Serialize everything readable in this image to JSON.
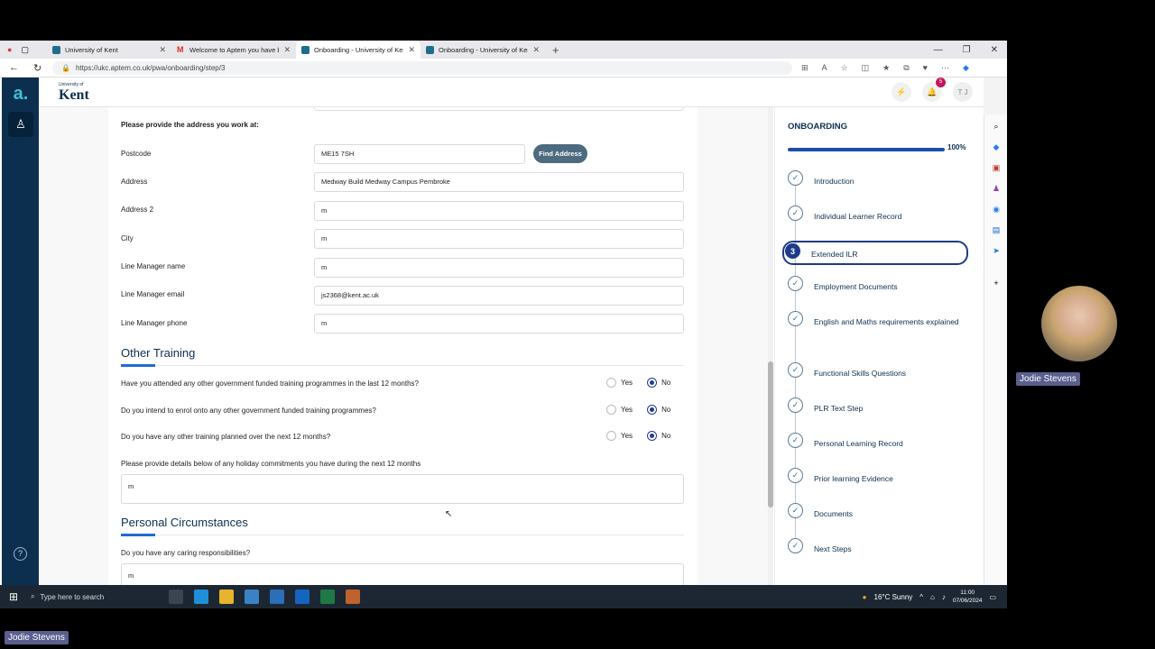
{
  "browser": {
    "tabs": [
      {
        "title": "University of Kent",
        "active": false,
        "favicon": "aptem"
      },
      {
        "title": "Welcome to Aptem you have be",
        "active": false,
        "favicon": "gmail"
      },
      {
        "title": "Onboarding - University of Kent",
        "active": true,
        "favicon": "aptem"
      },
      {
        "title": "Onboarding - University of Kent",
        "active": false,
        "favicon": "aptem"
      }
    ],
    "url": "https://ukc.aptem.co.uk/pwa/onboarding/step/3"
  },
  "header": {
    "brand_small": "University of",
    "brand_big": "Kent",
    "notification_count": "5",
    "user_initials": "T J"
  },
  "form": {
    "address_heading": "Please provide the address you work at:",
    "postcode_label": "Postcode",
    "postcode_value": "ME15 7SH",
    "find_address": "Find Address",
    "address_label": "Address",
    "address_value": "Medway Build Medway Campus Pembroke",
    "address2_label": "Address 2",
    "address2_value": "m",
    "city_label": "City",
    "city_value": "m",
    "manager_name_label": "Line Manager name",
    "manager_name_value": "m",
    "manager_email_label": "Line Manager email",
    "manager_email_value": "js2368@kent.ac.uk",
    "manager_phone_label": "Line Manager phone",
    "manager_phone_value": "m",
    "other_training_title": "Other Training",
    "q1": "Have you attended any other government funded training programmes in the last 12 months?",
    "q2": "Do you intend to enrol onto any other government funded training programmes?",
    "q3": "Do you have any other training planned over the next 12 months?",
    "yes": "Yes",
    "no": "No",
    "holiday_label": "Please provide details below of any holiday commitments you have during the next 12 months",
    "holiday_value": "m",
    "personal_title": "Personal Circumstances",
    "caring_label": "Do you have any caring responsibilities?",
    "caring_value": "m"
  },
  "panel": {
    "title": "ONBOARDING",
    "progress_percent": 100,
    "progress_label": "100%",
    "active_step_number": "3",
    "steps": [
      "Introduction",
      "Individual Learner Record",
      "Extended ILR",
      "Employment Documents",
      "English and Maths requirements explained",
      "Functional Skills Questions",
      "PLR Text Step",
      "Personal Learning Record",
      "Prior learning Evidence",
      "Documents",
      "Next Steps"
    ]
  },
  "taskbar": {
    "search_placeholder": "Type here to search",
    "weather": "16°C  Sunny",
    "time": "11:00",
    "date": "07/06/2024"
  },
  "participant": {
    "name": "Jodie Stevens"
  },
  "colors": {
    "navy": "#0d2f4f",
    "accent": "#1e3a8a",
    "find_button": "#4d6b7f"
  }
}
